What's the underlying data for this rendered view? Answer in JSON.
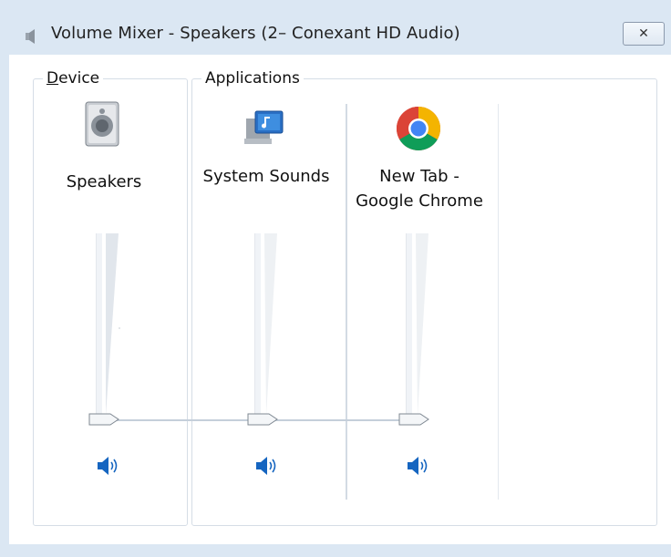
{
  "window": {
    "title": "Volume Mixer - Speakers (2– Conexant HD Audio)",
    "close_label": "✕"
  },
  "device": {
    "group_label_underlined": "D",
    "group_label_rest": "evice",
    "channels": [
      {
        "name": "Speakers",
        "icon": "speaker-device-icon",
        "volume_fraction": 0.0
      }
    ]
  },
  "applications": {
    "group_label": "Applications",
    "channels": [
      {
        "name": "System Sounds",
        "icon": "system-sounds-icon",
        "volume_fraction": 0.0
      },
      {
        "name_line1": "New Tab -",
        "name_line2": "Google Chrome",
        "icon": "chrome-icon",
        "volume_fraction": 0.0
      }
    ]
  },
  "colors": {
    "accent_blue": "#1565c0",
    "frame": "#dbe7f3"
  }
}
